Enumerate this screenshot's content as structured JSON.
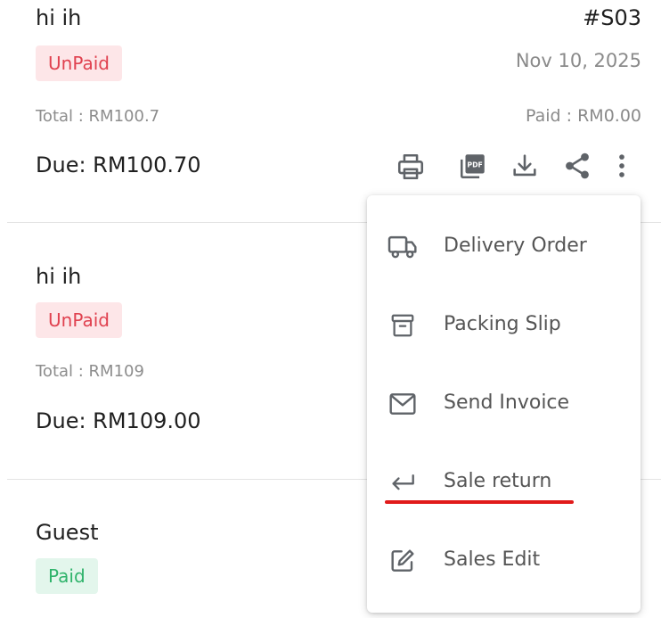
{
  "invoices": [
    {
      "customer": "hi ih",
      "status": "UnPaid",
      "status_type": "unpaid",
      "invoice_no": "#S03",
      "date": "Nov 10, 2025",
      "total": "Total : RM100.7",
      "paid": "Paid : RM0.00",
      "due": "Due: RM100.70",
      "actions": [
        "printer-icon",
        "pdf-icon",
        "download-icon",
        "share-icon",
        "more-vertical-icon"
      ]
    },
    {
      "customer": "hi ih",
      "status": "UnPaid",
      "status_type": "unpaid",
      "total": "Total : RM109",
      "due": "Due: RM109.00"
    },
    {
      "customer": "Guest",
      "status": "Paid",
      "status_type": "paid"
    }
  ],
  "menu": {
    "items": [
      {
        "label": "Delivery Order",
        "icon": "truck-icon"
      },
      {
        "label": "Packing Slip",
        "icon": "archive-box-icon"
      },
      {
        "label": "Send Invoice",
        "icon": "mail-icon"
      },
      {
        "label": "Sale return",
        "icon": "return-arrow-icon",
        "highlighted": true
      },
      {
        "label": "Sales Edit",
        "icon": "edit-icon"
      }
    ]
  },
  "colors": {
    "unpaid_bg": "#fde6e8",
    "unpaid_text": "#e0414f",
    "paid_bg": "#e3f6ec",
    "paid_text": "#2fb36b",
    "highlight_underline": "#e11a1a",
    "icon_gray": "#5f6368"
  }
}
